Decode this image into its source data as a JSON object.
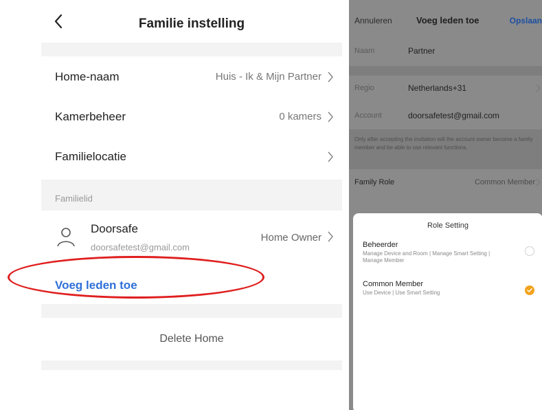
{
  "left": {
    "title": "Familie instelling",
    "rows": [
      {
        "label": "Home-naam",
        "value": "Huis - Ik & Mijn Partner"
      },
      {
        "label": "Kamerbeheer",
        "value": "0 kamers"
      },
      {
        "label": "Familielocatie",
        "value": ""
      }
    ],
    "section_label": "Familielid",
    "member": {
      "name": "Doorsafe",
      "email": "doorsafetest@gmail.com",
      "role": "Home Owner"
    },
    "add_member_label": "Voeg leden toe",
    "delete_label": "Delete Home",
    "highlight_color": "#e01e1e",
    "accent_color": "#2e6fd9"
  },
  "right": {
    "header": {
      "cancel": "Annuleren",
      "title": "Voeg leden toe",
      "save": "Opslaan"
    },
    "fields": [
      {
        "label": "Naam",
        "value": "Partner"
      },
      {
        "label": "Regio",
        "value": "Netherlands+31"
      },
      {
        "label": "Account",
        "value": "doorsafetest@gmail.com"
      }
    ],
    "hint": "Only after accepting the invitation will the account owner become a family member and be able to use relevant functions.",
    "family_role": {
      "label": "Family Role",
      "value": "Common Member"
    },
    "role_sheet": {
      "title": "Role Setting",
      "options": [
        {
          "name": "Beheerder",
          "description": "Manage Device and Room | Manage Smart Setting | Manage Member",
          "selected": false
        },
        {
          "name": "Common Member",
          "description": "Use Device | Use Smart Setting",
          "selected": true
        }
      ],
      "selected_color": "#f2a31c"
    }
  }
}
